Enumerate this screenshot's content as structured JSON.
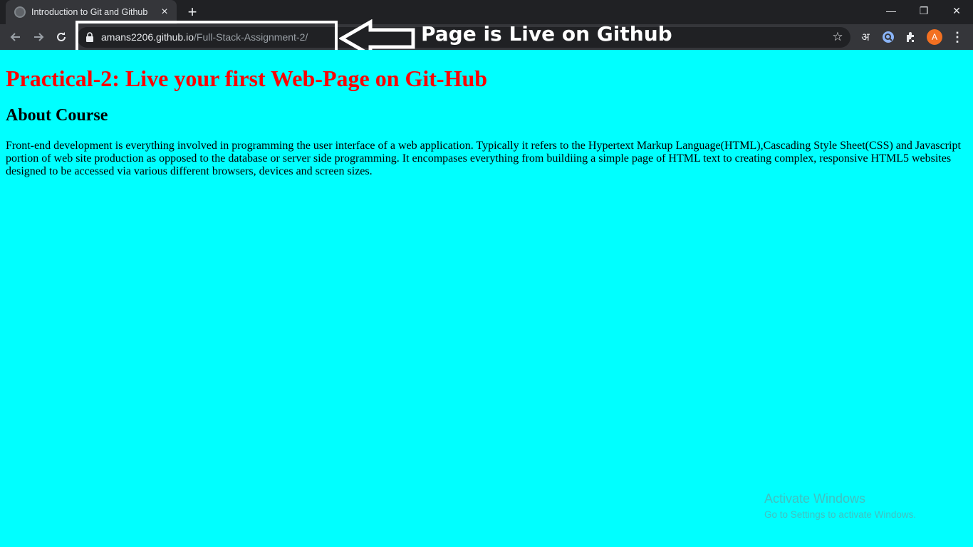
{
  "browser": {
    "tab_title": "Introduction to Git and Github",
    "tab_close": "×",
    "new_tab": "+",
    "url_host": "amans2206.github.io",
    "url_path": "/Full-Stack-Assignment-2/",
    "translate_glyph": "अ",
    "avatar_letter": "A",
    "window_controls": {
      "minimize": "—",
      "restore": "❐",
      "close": "✕"
    }
  },
  "annotation": {
    "text": "Page is Live on Github"
  },
  "page": {
    "heading": "Practical-2: Live your first Web-Page on Git-Hub",
    "subheading": "About Course",
    "paragraph": "Front-end development is everything involved in programming the user interface of a web application. Typically it refers to the Hypertext Markup Language(HTML),Cascading Style Sheet(CSS) and Javascript portion of web site production as opposed to the database or server side programming. It encompases everything from buildiing a simple page of HTML text to creating complex, responsive HTML5 websites designed to be accessed via various different browsers, devices and screen sizes."
  },
  "watermark": {
    "title": "Activate Windows",
    "subtitle": "Go to Settings to activate Windows."
  },
  "colors": {
    "page_background": "#00ffff",
    "heading_color": "#ff0000",
    "chrome_dark": "#202124",
    "chrome_toolbar": "#35363a",
    "avatar": "#f37021"
  }
}
